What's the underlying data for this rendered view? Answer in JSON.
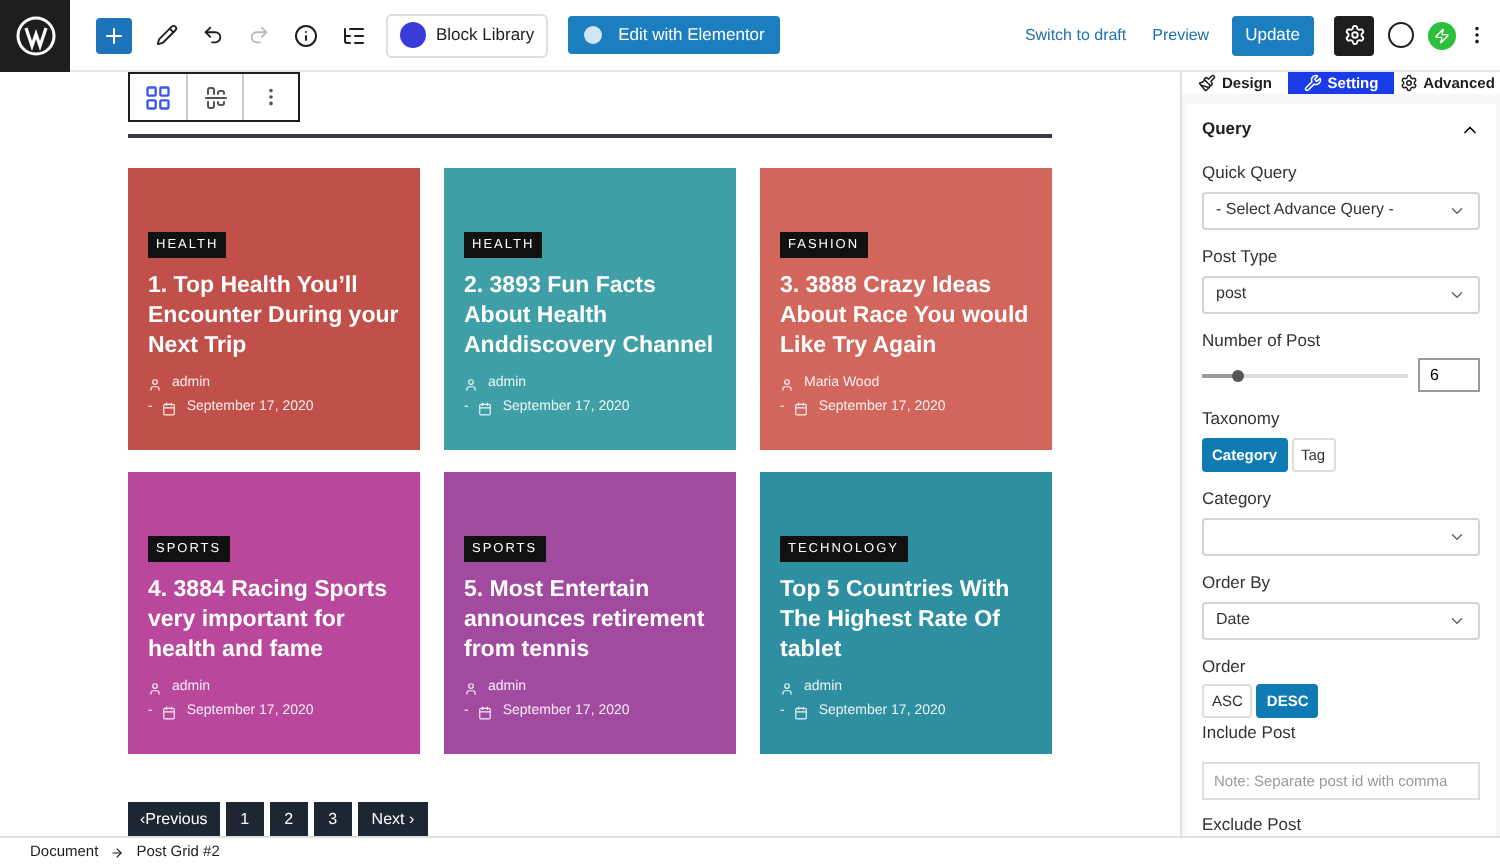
{
  "toolbar": {
    "library_button": "Block Library",
    "elementor_button": "Edit with Elementor",
    "switch_draft": "Switch to draft",
    "preview": "Preview",
    "update": "Update",
    "settings_selected": true,
    "redo_disabled": true
  },
  "block_toolbar": [
    {
      "kind": "grid",
      "selected": true
    },
    {
      "kind": "align",
      "selected": false
    },
    {
      "kind": "more",
      "selected": false
    }
  ],
  "posts": [
    {
      "category": "HEALTH",
      "title": "1. Top Health You’ll Encounter During your Next Trip",
      "author": "admin",
      "separator": "-",
      "date": "September 17, 2020",
      "color": "#c2504a"
    },
    {
      "category": "HEALTH",
      "title": "2. 3893 Fun Facts About Health Anddiscovery Channel",
      "author": "admin",
      "separator": "-",
      "date": "September 17, 2020",
      "color": "#3f9fa6"
    },
    {
      "category": "FASHION",
      "title": "3. 3888 Crazy Ideas About Race You would Like Try Again",
      "author": "Maria Wood",
      "separator": "-",
      "date": "September 17, 2020",
      "color": "#d2665c"
    },
    {
      "category": "SPORTS",
      "title": "4. 3884 Racing Sports very important for health and fame",
      "author": "admin",
      "separator": "-",
      "date": "September 17, 2020",
      "color": "#b9479c"
    },
    {
      "category": "SPORTS",
      "title": "5. Most Entertain announces retirement from tennis",
      "author": "admin",
      "separator": "-",
      "date": "September 17, 2020",
      "color": "#a24aa0"
    },
    {
      "category": "TECHNOLOGY",
      "title": "Top 5 Countries With The Highest Rate Of tablet",
      "author": "admin",
      "separator": "-",
      "date": "September 17, 2020",
      "color": "#2e8fa0"
    }
  ],
  "pagination": {
    "previous": "‹Previous",
    "pages": [
      "1",
      "2",
      "3"
    ],
    "next": "Next ›"
  },
  "sidebar": {
    "tabs": [
      {
        "label": "Design",
        "selected": false
      },
      {
        "label": "Setting",
        "selected": true
      },
      {
        "label": "Advanced",
        "selected": false
      }
    ],
    "section": {
      "title": "Query",
      "expanded": true
    },
    "quick_query": {
      "label": "Quick Query",
      "value": "- Select Advance Query -"
    },
    "post_type": {
      "label": "Post Type",
      "value": "post"
    },
    "number_of_post": {
      "label": "Number of Post",
      "level": 0.17,
      "value": "6"
    },
    "taxonomy": {
      "label": "Taxonomy",
      "options": [
        {
          "label": "Category",
          "selected": true
        },
        {
          "label": "Tag",
          "selected": false
        }
      ]
    },
    "category": {
      "label": "Category"
    },
    "order_by": {
      "label": "Order By",
      "value": "Date"
    },
    "order": {
      "label": "Order",
      "options": [
        {
          "label": "ASC",
          "selected": false
        },
        {
          "label": "DESC",
          "selected": true
        }
      ]
    },
    "include_post": {
      "label": "Include Post",
      "placeholder": "Note: Separate post id with comma"
    },
    "exclude_post": {
      "label": "Exclude Post"
    }
  },
  "breadcrumb": [
    "Document",
    "Post Grid #2"
  ]
}
